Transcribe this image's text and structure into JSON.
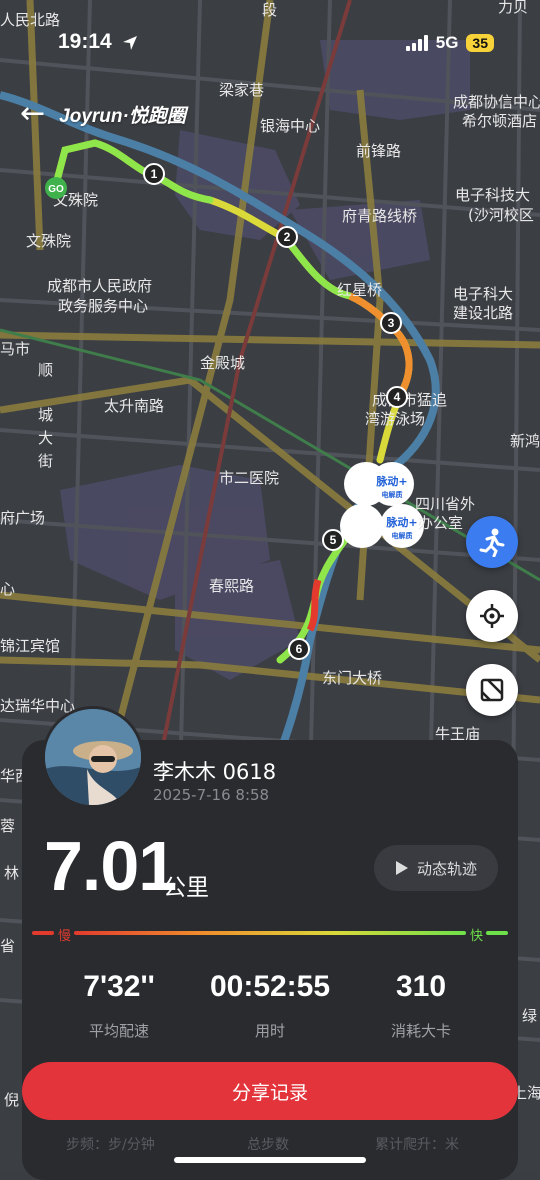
{
  "status": {
    "time": "19:14",
    "network": "5G",
    "battery": "35"
  },
  "header": {
    "brand": "Joyrun·悦跑圈"
  },
  "map": {
    "labels": [
      "人民北路",
      "段",
      "力贝",
      "梁家巷",
      "银海中心",
      "成都协信中心",
      "希尔顿酒店",
      "前锋路",
      "电子科技大",
      "(沙河校区",
      "府青路线桥",
      "文殊院",
      "文殊院",
      "成都市人民政府",
      "政务服务中心",
      "红星桥",
      "电子科大",
      "建设北路",
      "马市",
      "金殿城",
      "顺",
      "城",
      "大",
      "街",
      "太升南路",
      "成都市猛追",
      "湾游泳场",
      "新鸿",
      "市二医院",
      "四川省外",
      "办公室",
      "府广场",
      "春熙路",
      "心",
      "锦江宾馆",
      "东门大桥",
      "达瑞华中心",
      "牛王庙",
      "华西",
      "蓉",
      "林",
      "省",
      "绿",
      "上海",
      "倪"
    ],
    "start_badge": "GO",
    "markers": [
      "1",
      "2",
      "3",
      "4",
      "5",
      "6"
    ],
    "promo_label": "脉动+",
    "promo_sub": "电解质"
  },
  "user": {
    "name": "李木木 0618",
    "datetime": "2025-7-16 8:58"
  },
  "summary": {
    "distance": "7.01",
    "unit": "公里",
    "replay_label": "动态轨迹",
    "slow_label": "慢",
    "fast_label": "快"
  },
  "stats": [
    {
      "value": "7'32''",
      "label": "平均配速"
    },
    {
      "value": "00:52:55",
      "label": "用时"
    },
    {
      "value": "310",
      "label": "消耗大卡"
    }
  ],
  "share_label": "分享记录",
  "bottom_labels": [
    "步频：步/分钟",
    "总步数",
    "累计爬升：米"
  ],
  "colors": {
    "accent": "#e3343c",
    "route_fast": "#6ee04a",
    "route_slow": "#e23b2e",
    "card": "#2a2b2f"
  },
  "icons": [
    "location-arrow-icon",
    "signal-icon",
    "back-arrow-icon",
    "runner-icon",
    "locate-icon",
    "map-layer-icon",
    "play-icon"
  ]
}
